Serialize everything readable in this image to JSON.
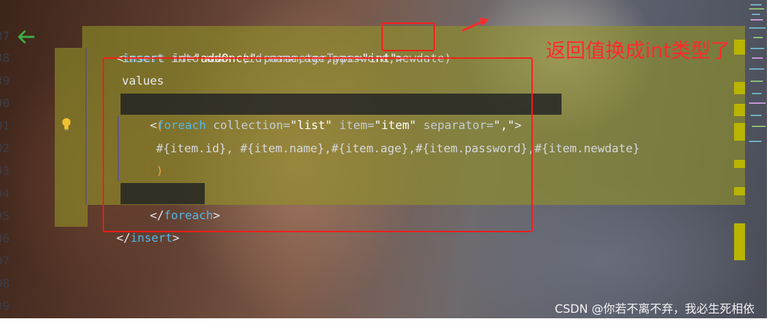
{
  "editor": {
    "line_numbers": [
      "37",
      "38",
      "39",
      "90",
      "91",
      "92",
      "93",
      "94",
      "95",
      "96",
      "97",
      "98",
      "99"
    ],
    "lines": {
      "insert_open": {
        "lt": "<",
        "tag": "insert",
        "sp1": " ",
        "attr1": "id=",
        "val1": "\"addOnce\"",
        "sp2": " ",
        "attr2": "parameterType=",
        "val2": "\"int\"",
        "gt": ">"
      },
      "insert_into": "insert into user (id,name,age,password,newdate)",
      "values": "values",
      "foreach_open": {
        "lt": "<",
        "tag": "foreach",
        "sp1": " ",
        "attr1": "collection=",
        "val1": "\"list\"",
        "sp2": " ",
        "attr2": "item=",
        "val2": "\"item\"",
        "sp3": " ",
        "attr3": "separator=",
        "val3": "\",\"",
        "gt": ">"
      },
      "paren_open": "(",
      "item_expr": "#{item.id}, #{item.name},#{item.age},#{item.password},#{item.newdate}",
      "paren_close": ")",
      "foreach_close": {
        "lt": "</",
        "tag": "foreach",
        "gt": ">"
      },
      "insert_close": {
        "lt": "</",
        "tag": "insert",
        "gt": ">"
      }
    }
  },
  "annotation": {
    "text": "返回值换成int类型了",
    "color": "#ff2a2a"
  },
  "watermark": "CSDN @你若不离不弃，我必生死相依",
  "colors": {
    "tag": "#56b6e6",
    "highlight": "#929228",
    "redbox": "#ff1a1a",
    "back_arrow": "#3cb043"
  },
  "icons": {
    "gutter_arrow": "arrow-left-icon",
    "bulb": "lightbulb-icon",
    "pointer": "arrow-up-right-icon"
  }
}
